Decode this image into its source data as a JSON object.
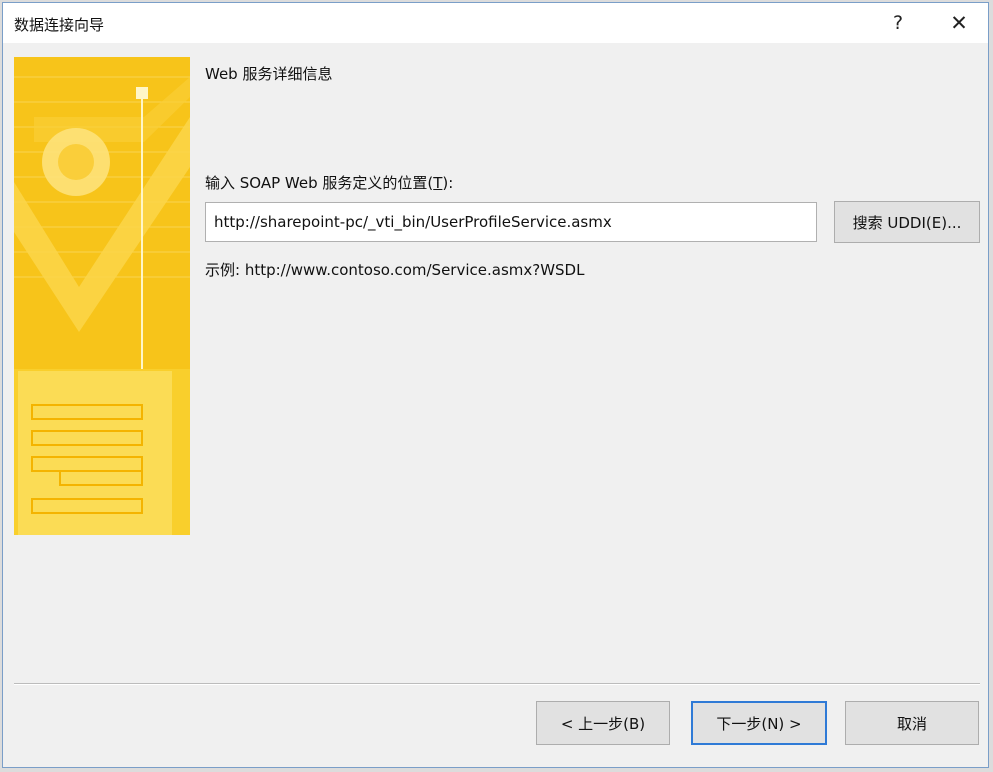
{
  "window": {
    "title": "数据连接向导",
    "help_glyph": "?",
    "close_glyph": "✕"
  },
  "page": {
    "heading": "Web 服务详细信息",
    "url_label_prefix": "输入 SOAP Web 服务定义的位置(",
    "url_label_key": "T",
    "url_label_suffix": "):",
    "url_value": "http://sharepoint-pc/_vti_bin/UserProfileService.asmx",
    "uddi_button": "搜索 UDDI(E)...",
    "example": "示例: http://www.contoso.com/Service.asmx?WSDL"
  },
  "footer": {
    "back_button": "< 上一步(B)",
    "next_button": "下一步(N) >",
    "cancel_button": "取消"
  },
  "colors": {
    "banner": "#f7c41a",
    "default_button_border": "#2f7ad6"
  }
}
